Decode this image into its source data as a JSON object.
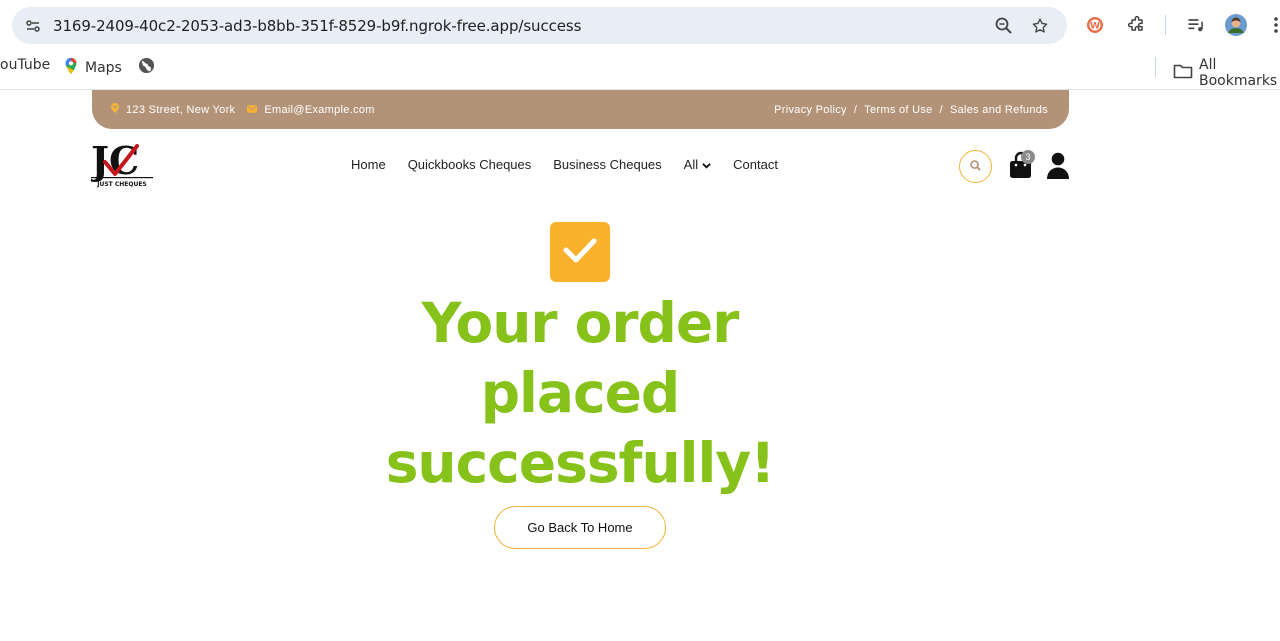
{
  "browser": {
    "url": "3169-2409-40c2-2053-ad3-b8bb-351f-8529-b9f.ngrok-free.app/success",
    "bookmarks": [
      {
        "label": "ouTube",
        "icon": "youtube-icon"
      },
      {
        "label": "Maps",
        "icon": "maps-icon"
      },
      {
        "label": "",
        "icon": "globe-icon"
      }
    ],
    "all_bookmarks_label": "All Bookmarks"
  },
  "topbar": {
    "address": "123 Street, New York",
    "email": "Email@Example.com",
    "links": [
      "Privacy Policy",
      "Terms of Use",
      "Sales and Refunds"
    ],
    "separator": "/",
    "background": "#b39377"
  },
  "logo": {
    "text": "JC",
    "tagline": "JUST CHEQUES"
  },
  "nav": {
    "items": [
      "Home",
      "Quickbooks Cheques",
      "Business Cheques",
      "All",
      "Contact"
    ]
  },
  "header_icons": {
    "cart_count": "3"
  },
  "main": {
    "headline": "Your order placed successfully!",
    "button_label": "Go Back To Home",
    "accent": "#86c21a",
    "check_color": "#fbb12b"
  }
}
